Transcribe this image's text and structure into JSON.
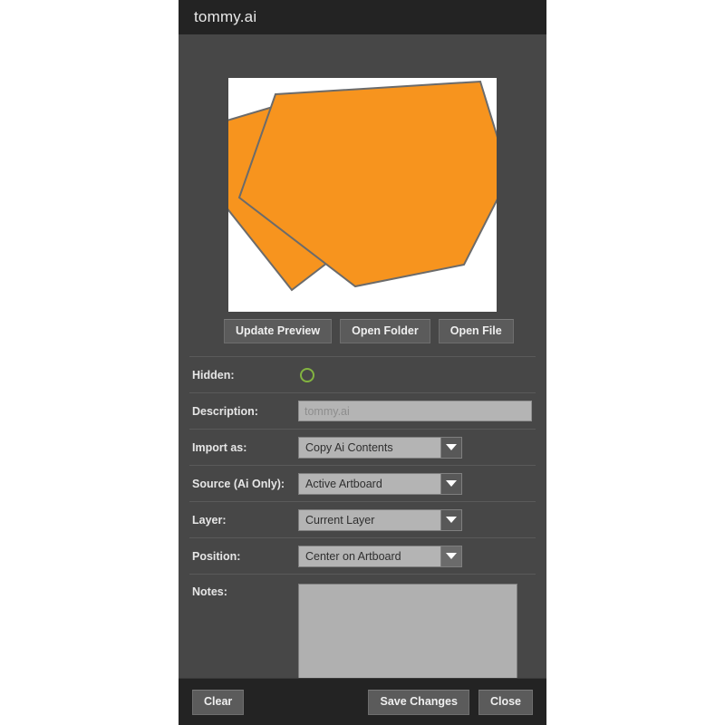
{
  "window": {
    "title": "tommy.ai"
  },
  "preview": {
    "alt": "hexagon-artwork-preview",
    "background_color": "#ffffff",
    "shape_fill": "#F7941E",
    "shape_stroke": "#6b6b6b",
    "shapes": [
      "hexagon-back",
      "hexagon-front"
    ]
  },
  "preview_buttons": [
    {
      "label": "Update Preview",
      "name": "update-preview-button"
    },
    {
      "label": "Open Folder",
      "name": "open-folder-button"
    },
    {
      "label": "Open File",
      "name": "open-file-button"
    }
  ],
  "fields": {
    "hidden": {
      "label": "Hidden:",
      "toggle_state": "off",
      "toggle_color": "#83b440"
    },
    "description": {
      "label": "Description:",
      "value": "",
      "placeholder": "tommy.ai"
    },
    "import_as": {
      "label": "Import as:",
      "value": "Copy Ai Contents"
    },
    "source": {
      "label": "Source (Ai Only):",
      "value": "Active Artboard"
    },
    "layer": {
      "label": "Layer:",
      "value": "Current Layer"
    },
    "position": {
      "label": "Position:",
      "value": "Center on Artboard"
    },
    "notes": {
      "label": "Notes:",
      "value": "",
      "placeholder": ""
    }
  },
  "footer": {
    "clear_label": "Clear",
    "save_label": "Save Changes",
    "close_label": "Close"
  },
  "colors": {
    "panel_background": "#474747",
    "titlebar_background": "#232323",
    "footer_background": "#232323",
    "button_face": "#5b5b5b",
    "input_face": "#b4b4b4",
    "accent_green": "#83b440",
    "accent_orange": "#F7941E"
  }
}
